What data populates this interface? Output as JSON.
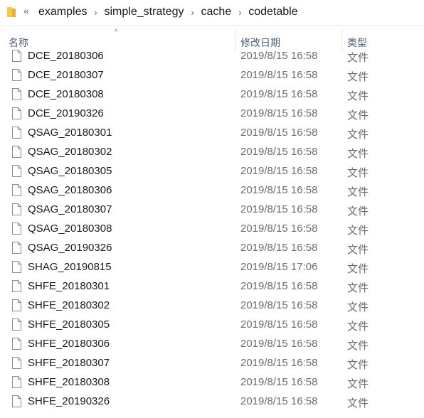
{
  "address": {
    "overflow_glyph": "«",
    "crumbs": [
      "examples",
      "simple_strategy",
      "cache",
      "codetable"
    ]
  },
  "columns": {
    "name": "名称",
    "date": "修改日期",
    "type": "类型"
  },
  "files": [
    {
      "name": "DCE_20180306",
      "date": "2019/8/15 16:58",
      "type": "文件"
    },
    {
      "name": "DCE_20180307",
      "date": "2019/8/15 16:58",
      "type": "文件"
    },
    {
      "name": "DCE_20180308",
      "date": "2019/8/15 16:58",
      "type": "文件"
    },
    {
      "name": "DCE_20190326",
      "date": "2019/8/15 16:58",
      "type": "文件"
    },
    {
      "name": "QSAG_20180301",
      "date": "2019/8/15 16:58",
      "type": "文件"
    },
    {
      "name": "QSAG_20180302",
      "date": "2019/8/15 16:58",
      "type": "文件"
    },
    {
      "name": "QSAG_20180305",
      "date": "2019/8/15 16:58",
      "type": "文件"
    },
    {
      "name": "QSAG_20180306",
      "date": "2019/8/15 16:58",
      "type": "文件"
    },
    {
      "name": "QSAG_20180307",
      "date": "2019/8/15 16:58",
      "type": "文件"
    },
    {
      "name": "QSAG_20180308",
      "date": "2019/8/15 16:58",
      "type": "文件"
    },
    {
      "name": "QSAG_20190326",
      "date": "2019/8/15 16:58",
      "type": "文件"
    },
    {
      "name": "SHAG_20190815",
      "date": "2019/8/15 17:06",
      "type": "文件"
    },
    {
      "name": "SHFE_20180301",
      "date": "2019/8/15 16:58",
      "type": "文件"
    },
    {
      "name": "SHFE_20180302",
      "date": "2019/8/15 16:58",
      "type": "文件"
    },
    {
      "name": "SHFE_20180305",
      "date": "2019/8/15 16:58",
      "type": "文件"
    },
    {
      "name": "SHFE_20180306",
      "date": "2019/8/15 16:58",
      "type": "文件"
    },
    {
      "name": "SHFE_20180307",
      "date": "2019/8/15 16:58",
      "type": "文件"
    },
    {
      "name": "SHFE_20180308",
      "date": "2019/8/15 16:58",
      "type": "文件"
    },
    {
      "name": "SHFE_20190326",
      "date": "2019/8/15 16:58",
      "type": "文件"
    }
  ]
}
